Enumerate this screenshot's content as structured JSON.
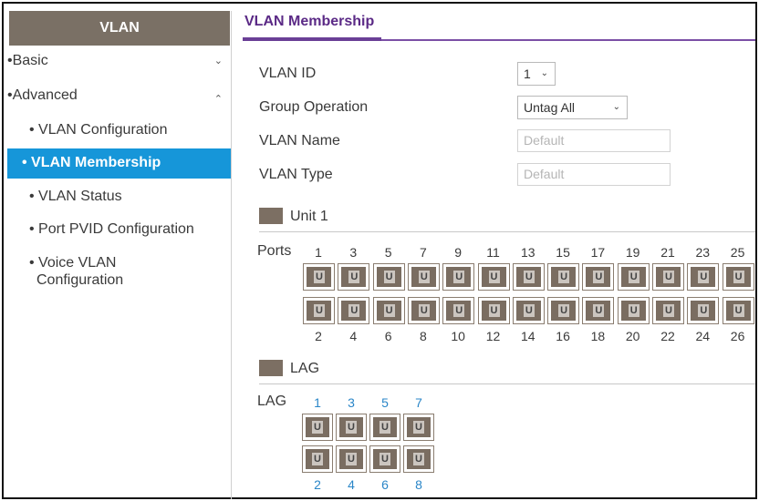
{
  "sidebar": {
    "header": "VLAN",
    "items": [
      {
        "label": "Basic",
        "bullet": "•",
        "chevron": "⌄"
      },
      {
        "label": "Advanced",
        "bullet": "•",
        "chevron": "⌃"
      }
    ],
    "subitems": [
      {
        "label": "• VLAN Configuration"
      },
      {
        "label": "• VLAN Membership",
        "active": true
      },
      {
        "label": "• VLAN Status"
      },
      {
        "label": "• Port PVID Configuration"
      },
      {
        "label": "• Voice VLAN Configuration",
        "line1": "• Voice VLAN",
        "line2": "Configuration"
      }
    ]
  },
  "tab": {
    "title": "VLAN Membership"
  },
  "form": {
    "vlan_id": {
      "label": "VLAN ID",
      "value": "1"
    },
    "group_operation": {
      "label": "Group Operation",
      "value": "Untag All"
    },
    "vlan_name": {
      "label": "VLAN Name",
      "value": "Default"
    },
    "vlan_type": {
      "label": "VLAN Type",
      "value": "Default"
    }
  },
  "unit": {
    "title": "Unit 1",
    "row_label": "Ports",
    "top_numbers": [
      "1",
      "3",
      "5",
      "7",
      "9",
      "11",
      "13",
      "15",
      "17",
      "19",
      "21",
      "23",
      "25"
    ],
    "bottom_numbers": [
      "2",
      "4",
      "6",
      "8",
      "10",
      "12",
      "14",
      "16",
      "18",
      "20",
      "22",
      "24",
      "26"
    ],
    "port_mark": "U"
  },
  "lag": {
    "title": "LAG",
    "row_label": "LAG",
    "top_numbers": [
      "1",
      "3",
      "5",
      "7"
    ],
    "bottom_numbers": [
      "2",
      "4",
      "6",
      "8"
    ],
    "port_mark": "U"
  },
  "colors": {
    "sidebar_header": "#7a7065",
    "active_item": "#1696d9",
    "tab_accent": "#6a3f96",
    "port": "#7a6d61",
    "lag_number": "#2a86c8"
  }
}
